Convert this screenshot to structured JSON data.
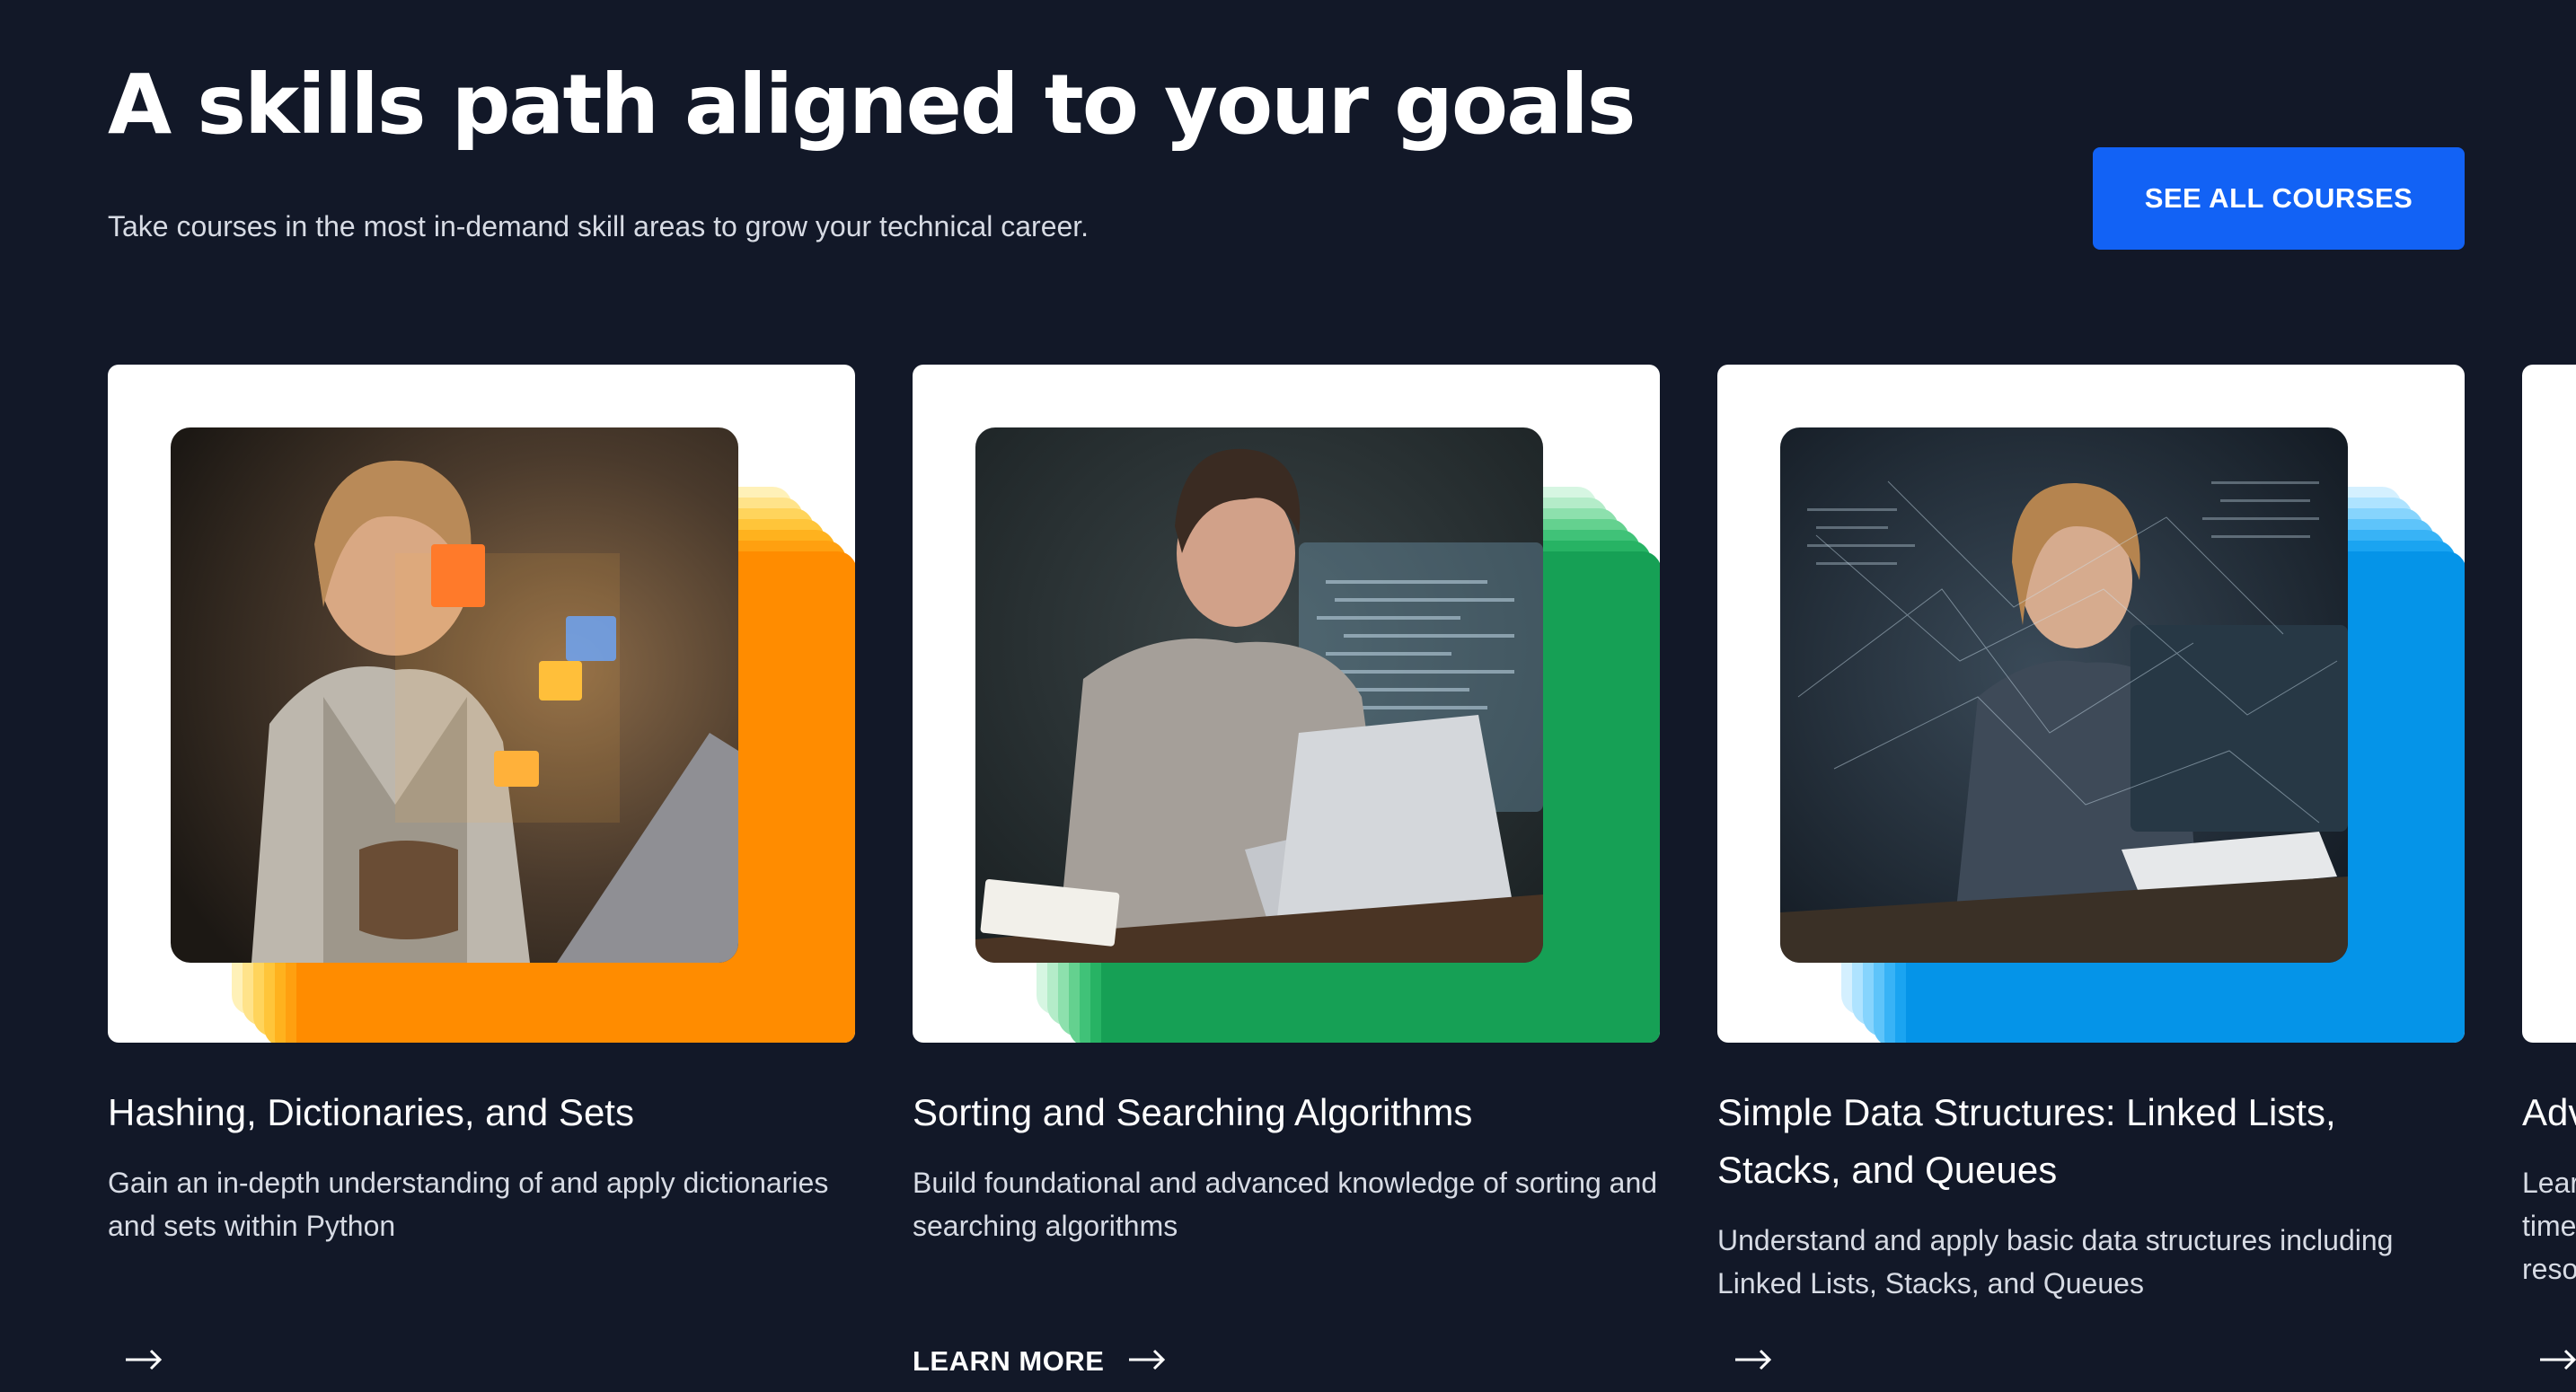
{
  "header": {
    "title": "A skills path aligned to your goals",
    "subtitle": "Take courses in the most in-demand skill areas to grow your technical career.",
    "cta_label": "SEE ALL COURSES"
  },
  "courses": [
    {
      "title": "Hashing, Dictionaries, and Sets",
      "description": "Gain an in-depth understanding of and apply dictionaries and sets within Python",
      "link_label": "",
      "accent": "#ff9800"
    },
    {
      "title": "Sorting and Searching Algorithms",
      "description": "Build foundational and advanced knowledge of sorting and searching algorithms",
      "link_label": "LEARN MORE",
      "accent": "#1aab5a"
    },
    {
      "title": "Simple Data Structures: Linked Lists, Stacks, and Queues",
      "description": "Understand and apply basic data structures including Linked Lists, Stacks, and Queues",
      "link_label": "",
      "accent": "#0a9ff0"
    },
    {
      "title": "Adv",
      "description_lines": [
        "Lear",
        "time",
        "reso"
      ],
      "link_label": ""
    }
  ],
  "icons": {
    "card_link": "arrow-right-icon"
  },
  "colors": {
    "background": "#121828",
    "cta": "#1262f5",
    "card": "#ffffff"
  }
}
